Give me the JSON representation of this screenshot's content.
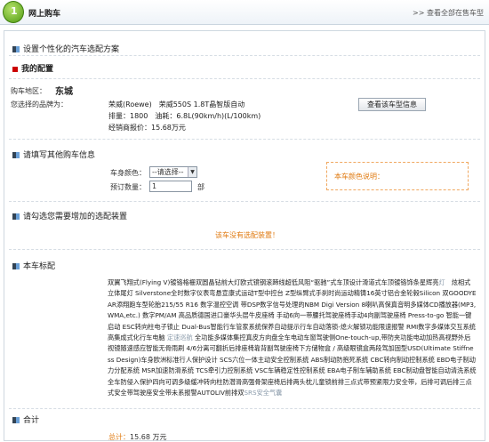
{
  "header": {
    "title": "网上购车",
    "link": ">> 查看全部在售车型"
  },
  "customize": {
    "heading": "设置个性化的汽车选配方案"
  },
  "config": {
    "heading": "我的配置",
    "region_label": "购车地区：",
    "region_value": "东城",
    "brand_label": "您选择的品牌为：",
    "brand_line1": "荣威(Roewe)　荣威550S 1.8T晶智版自动",
    "brand_line2": "排量：1800　油耗：6.8L(90km/h)(L/100km)",
    "brand_line3": "经销商报价：15.68万元",
    "info_button": "查看该车型信息"
  },
  "other_info": {
    "heading": "请填写其他购车信息",
    "color_label": "车身颜色：",
    "color_selected": "--请选择--",
    "qty_label": "预订数量：",
    "qty_value": "1",
    "qty_unit": "部",
    "note": "本车颜色说明："
  },
  "optional": {
    "heading": "请勾选您需要增加的选配装置",
    "message": "该车没有选配装置！"
  },
  "standard": {
    "heading": "本车标配",
    "segments": [
      {
        "text": "双翼飞翔式(Flying V)镀铬格栅双圆晶钻前大灯欧式镜钢滚蹄线超低风阻“驱驰”式车顶设计滑道式车顶镀铬饰条星辉亮",
        "gray": false
      },
      {
        "text": "灯",
        "gray": true
      },
      {
        "text": "　炫相式立体尾灯 Silverstone全时数字仪表弯悬宣康式运动T型中控台 Z型纵臂式手刹时尚运动精铸16英寸铝合金轮毂Silicon 双GOODYEAR添翔跑车型轮胎215/55 R16 数字温控空调 带DSP数字信号处理的NBM Digi Version 8喇叭高保真音明多媒体CD播放器(MP3,WMA,etc.) 数字PM/AM 高品质德国进口豪华头层牛皮座椅 手动6向一带腰托驾驶座椅手动4向副驾驶座椅 Press-to-go 智能一键启动 ESC转向柱电子锁止 Dual-Bus智能行车管家系统保养自动提示行车自动落锁-熄火解锁功能限速报警 RMI数字多媒体交互系统高集成式化行车电脑 ",
        "gray": false
      },
      {
        "text": "定速巡航",
        "gray": true
      },
      {
        "text": " 全功能多媒体集控真皮方向盘全车电动车窗驾驶侧One-touch-up,带防夹功能电动加热高视野外后视镜随速感应智能无骨雨刷 4/6分离可翻折后排座椅靠背副驾驶座椅下方储物盒 / 高级眼镜盒两段驾加固型USD(Ultimate Stiffness Design)车身欧洲标准行人保护设计 ",
        "gray": false
      },
      {
        "text": "SCS六位一体主动安全控制系统 ABS制动防抱死系统 CBC转向制动控制系统 EBD电子制动力分配系统 MSR加速防滑系统 TCS牵引力控制系统 VSC车辆稳定性控制系统 EBA电子制车辅助系统 EBC制动盘智能自动清洗系统全车防侵入保护四向可调多级缓冲转向柱防潜滑高强骨架座椅后排两头枕儿童锁前排三点式带预紧限力安全带，后排可调后排三点式安全带驾驶座安全带未系报警AUTOLIV前排双",
        "gray": false
      },
      {
        "text": "SRS安全气囊",
        "gray": true
      }
    ]
  },
  "summary": {
    "heading": "合计",
    "total_label": "总计：",
    "total_value": "15.68 万元"
  },
  "colors": {
    "accent": "#e07a10",
    "header_bg": "#eef3f8",
    "section_bullet": "#6aa0d8"
  }
}
